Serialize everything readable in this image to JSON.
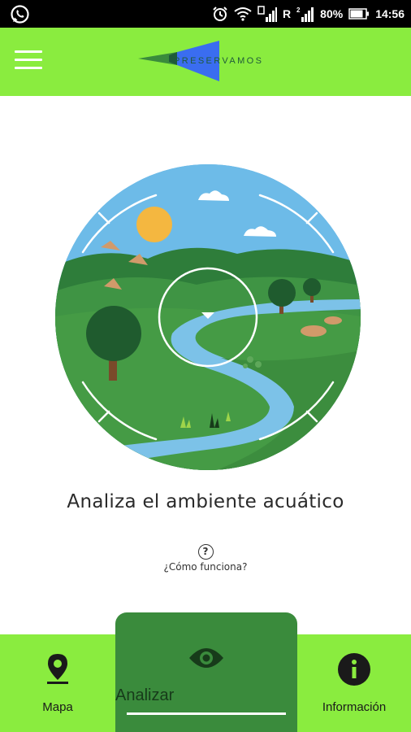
{
  "status_bar": {
    "carrier_char": "R",
    "battery_percent": "80%",
    "time": "14:56",
    "icons": [
      "whatsapp-icon",
      "alarm-icon",
      "wifi-icon",
      "signal-icon",
      "signal-icon",
      "battery-icon"
    ]
  },
  "header": {
    "logo_text": "PRESERVAMOS",
    "menu_icon": "hamburger-menu-icon",
    "colors": {
      "bar": "#8aec3f",
      "logo_green": "#3a8b3c",
      "logo_blue": "#3a6df0"
    }
  },
  "main": {
    "illustration": "river-landscape-scanner",
    "headline": "Analiza el ambiente acuático",
    "help_icon_glyph": "?",
    "help_text": "¿Cómo funciona?"
  },
  "bottom_nav": {
    "items": [
      {
        "label": "Mapa",
        "icon": "map-pin-icon",
        "active": false
      },
      {
        "label": "Analizar",
        "icon": "eye-icon",
        "active": true
      },
      {
        "label": "Información",
        "icon": "info-icon",
        "active": false
      }
    ],
    "colors": {
      "bar": "#8aec3f",
      "active_tab": "#3a8b3c"
    }
  }
}
